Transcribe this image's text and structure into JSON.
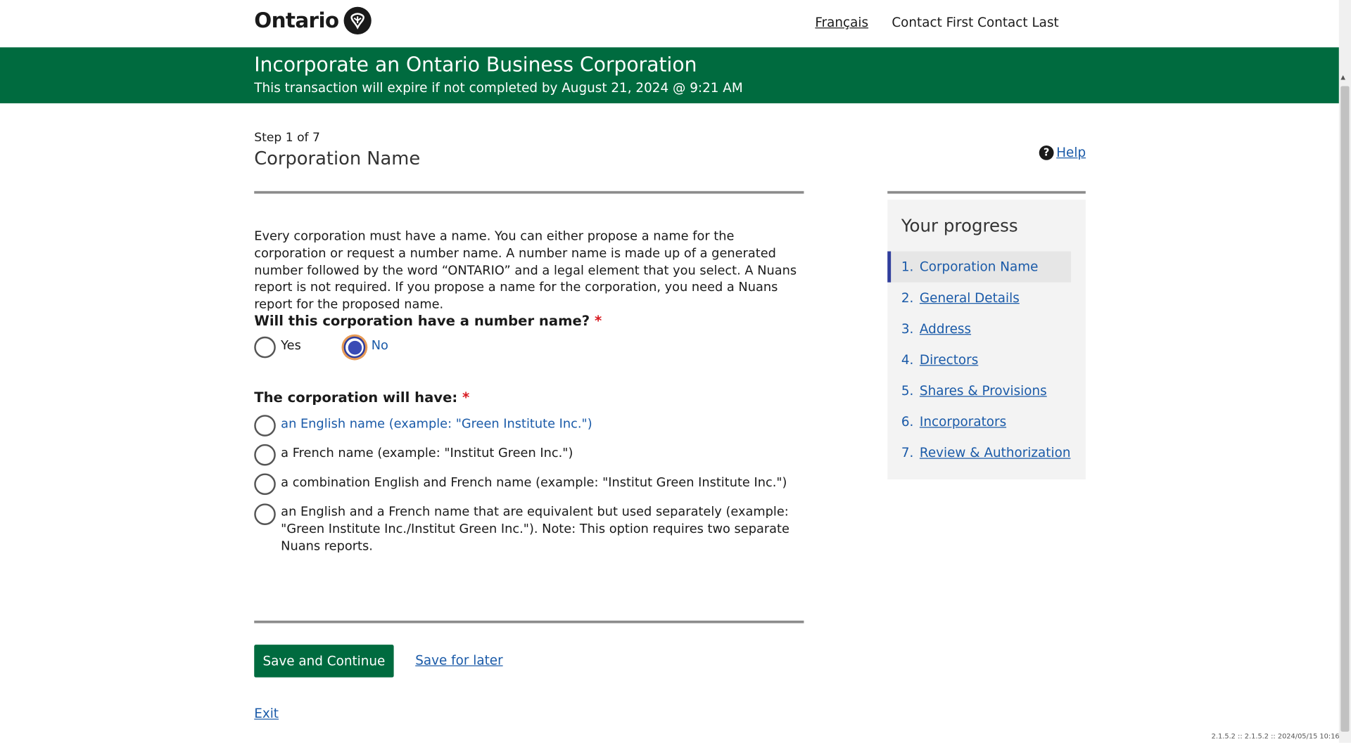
{
  "header": {
    "logo_text": "Ontario",
    "language_link": "Français",
    "user_name": "Contact First Contact Last"
  },
  "banner": {
    "title": "Incorporate an Ontario Business Corporation",
    "expiry": "This transaction will expire if not completed by August 21, 2024 @ 9:21 AM"
  },
  "page": {
    "step": "Step 1 of 7",
    "title": "Corporation Name",
    "help_label": "Help",
    "intro": "Every corporation must have a name. You can either propose a name for the corporation or request a number name. A number name is made up of a generated number followed by the word “ONTARIO” and a legal element that you select. A Nuans report is not required. If you propose a name for the corporation, you need a Nuans report for the proposed name."
  },
  "question1": {
    "label": "Will this corporation have a number name?",
    "required_mark": "*",
    "options": [
      {
        "label": "Yes",
        "selected": false
      },
      {
        "label": "No",
        "selected": true
      }
    ]
  },
  "question2": {
    "label": "The corporation will have:",
    "required_mark": "*",
    "options": [
      {
        "label": "an English name (example: \"Green Institute Inc.\")",
        "selected": false
      },
      {
        "label": "a French name (example: \"Institut Green Inc.\")",
        "selected": false
      },
      {
        "label": "a combination English and French name (example: \"Institut Green Institute Inc.\")",
        "selected": false
      },
      {
        "label": "an English and a French name that are equivalent but used separately (example: \"Green Institute Inc./Institut Green Inc.\"). Note: This option requires two separate Nuans reports.",
        "selected": false
      }
    ]
  },
  "progress": {
    "title": "Your progress",
    "items": [
      {
        "num": "1.",
        "label": "Corporation Name",
        "current": true
      },
      {
        "num": "2.",
        "label": "General Details"
      },
      {
        "num": "3.",
        "label": "Address"
      },
      {
        "num": "4.",
        "label": "Directors"
      },
      {
        "num": "5.",
        "label": "Shares & Provisions"
      },
      {
        "num": "6.",
        "label": "Incorporators"
      },
      {
        "num": "7.",
        "label": "Review & Authorization"
      }
    ]
  },
  "actions": {
    "save_continue": "Save and Continue",
    "save_later": "Save for later",
    "exit": "Exit"
  },
  "footer": {
    "version": "2.1.5.2 :: 2.1.5.2 :: 2024/05/15 10:16"
  },
  "colors": {
    "banner_green": "#006b3f",
    "link_blue": "#1a5aa8",
    "required_red": "#d81a21",
    "progress_accent": "#2f3d9c"
  }
}
